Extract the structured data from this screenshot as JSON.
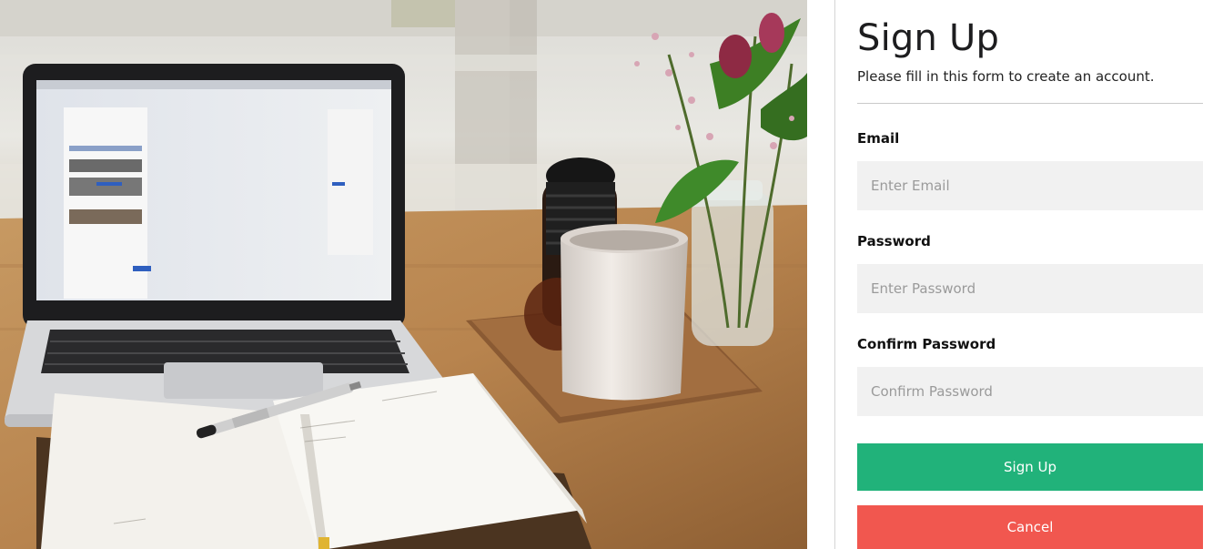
{
  "form": {
    "title": "Sign Up",
    "subtitle": "Please fill in this form to create an account.",
    "email": {
      "label": "Email",
      "placeholder": "Enter Email",
      "value": ""
    },
    "password": {
      "label": "Password",
      "placeholder": "Enter Password",
      "value": ""
    },
    "confirm_password": {
      "label": "Confirm Password",
      "placeholder": "Confirm Password",
      "value": ""
    },
    "signup_button": "Sign Up",
    "cancel_button": "Cancel"
  },
  "colors": {
    "signup": "#21b27a",
    "cancel": "#f1574f",
    "input_bg": "#f1f1f1"
  },
  "hero_image": {
    "subject": "laptop, open notebook with pen, coffee mug and flowers on a wooden table"
  }
}
